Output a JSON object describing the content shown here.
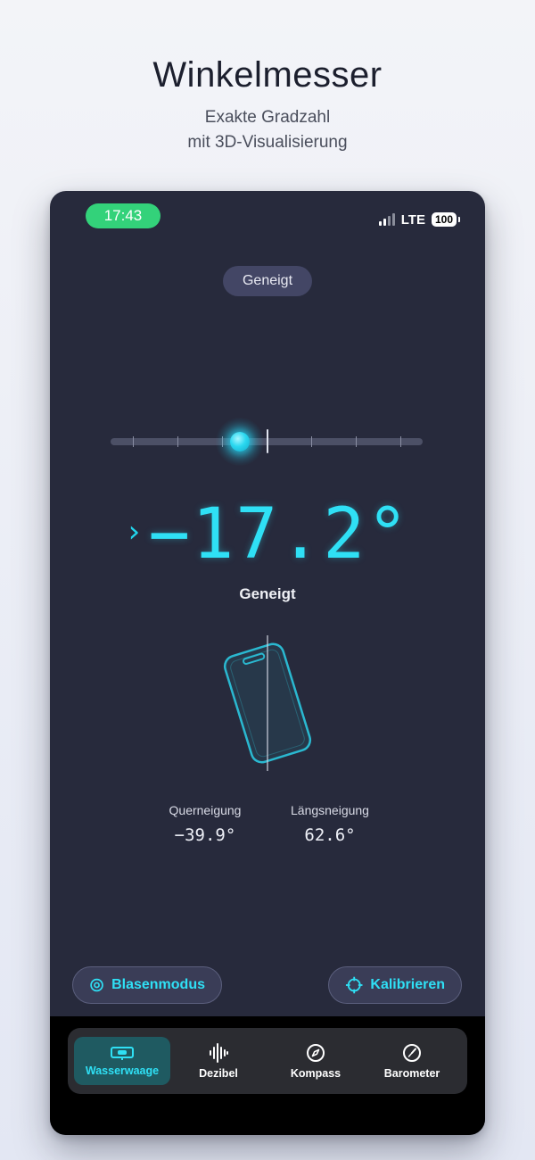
{
  "promo": {
    "title": "Winkelmesser",
    "subtitle_line1": "Exakte Gradzahl",
    "subtitle_line2": "mit 3D-Visualisierung"
  },
  "status_bar": {
    "time": "17:43",
    "network": "LTE",
    "battery": "100"
  },
  "mode_chip": "Geneigt",
  "level": {
    "bubble_offset_fraction": -0.09
  },
  "angle": {
    "value": "−17.2°",
    "state": "Geneigt",
    "direction_icon": "chevron-right-icon"
  },
  "tilt": {
    "cross_label": "Querneigung",
    "cross_value": "−39.9°",
    "long_label": "Längsneigung",
    "long_value": "62.6°"
  },
  "actions": {
    "bubble_mode": "Blasenmodus",
    "calibrate": "Kalibrieren"
  },
  "tabs": [
    {
      "label": "Wasserwaage",
      "icon": "spirit-level-icon",
      "active": true
    },
    {
      "label": "Dezibel",
      "icon": "sound-wave-icon",
      "active": false
    },
    {
      "label": "Kompass",
      "icon": "compass-icon",
      "active": false
    },
    {
      "label": "Barometer",
      "icon": "gauge-icon",
      "active": false
    }
  ],
  "colors": {
    "accent": "#2fe0f5",
    "screen_bg": "#272a3c",
    "status_time_bg": "#33d27a",
    "active_tab_bg": "#1f5a61"
  }
}
